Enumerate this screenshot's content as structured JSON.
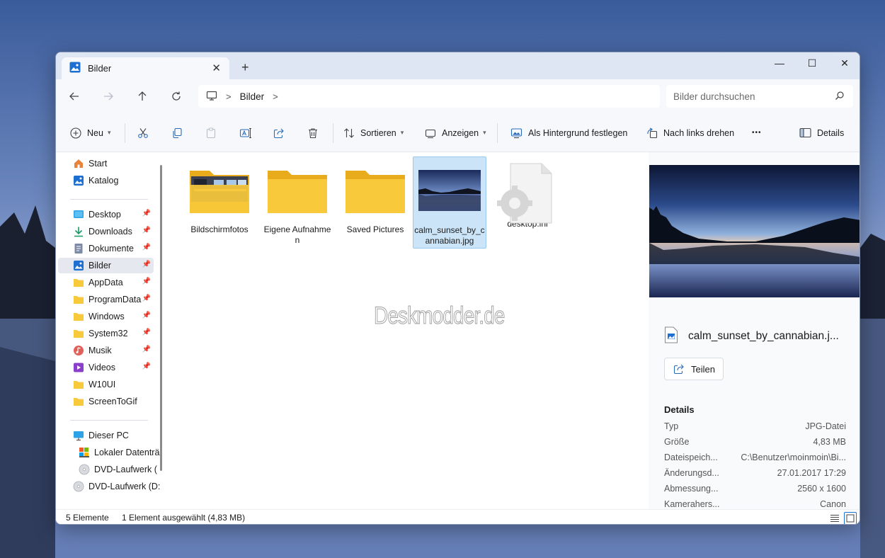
{
  "window": {
    "tab_title": "Bilder",
    "new_tab_symbol": "+",
    "tab_close_symbol": "✕",
    "minimize_symbol": "—",
    "maximize_symbol": "☐",
    "close_symbol": "✕"
  },
  "address": {
    "crumb": "Bilder",
    "search_placeholder": "Bilder durchsuchen"
  },
  "toolbar": {
    "new_label": "Neu",
    "sort_label": "Sortieren",
    "view_label": "Anzeigen",
    "wallpaper_label": "Als Hintergrund festlegen",
    "rotate_label": "Nach links drehen",
    "more_symbol": "•••",
    "details_label": "Details"
  },
  "sidebar": {
    "items": [
      {
        "label": "Start",
        "icon": "home-icon"
      },
      {
        "label": "Katalog",
        "icon": "gallery-icon"
      },
      {
        "label": "Desktop",
        "icon": "desktop-icon",
        "pinned": true
      },
      {
        "label": "Downloads",
        "icon": "download-icon",
        "pinned": true
      },
      {
        "label": "Dokumente",
        "icon": "document-icon",
        "pinned": true
      },
      {
        "label": "Bilder",
        "icon": "pictures-icon",
        "pinned": true,
        "active": true
      },
      {
        "label": "AppData",
        "icon": "folder-icon",
        "pinned": true
      },
      {
        "label": "ProgramData",
        "icon": "folder-icon",
        "pinned": true
      },
      {
        "label": "Windows",
        "icon": "folder-icon",
        "pinned": true
      },
      {
        "label": "System32",
        "icon": "folder-icon",
        "pinned": true
      },
      {
        "label": "Musik",
        "icon": "music-icon",
        "pinned": true
      },
      {
        "label": "Videos",
        "icon": "video-icon",
        "pinned": true
      },
      {
        "label": "W10UI",
        "icon": "folder-icon"
      },
      {
        "label": "ScreenToGif",
        "icon": "folder-icon"
      },
      {
        "label": "Dieser PC",
        "icon": "pc-icon"
      },
      {
        "label": "Lokaler Datenträ",
        "icon": "drive-icon"
      },
      {
        "label": "DVD-Laufwerk (",
        "icon": "dvd-icon"
      },
      {
        "label": "DVD-Laufwerk (D:",
        "icon": "dvd-icon"
      }
    ],
    "pin_symbol": "📌"
  },
  "files": [
    {
      "name": "Bildschirmfotos",
      "type": "folder-screenshots"
    },
    {
      "name": "Eigene Aufnahmen",
      "type": "folder"
    },
    {
      "name": "Saved Pictures",
      "type": "folder"
    },
    {
      "name": "calm_sunset_by_cannabian.jpg",
      "type": "image",
      "selected": true
    },
    {
      "name": "desktop.ini",
      "type": "settings-file"
    }
  ],
  "watermark": "Deskmodder.de",
  "preview": {
    "filename": "calm_sunset_by_cannabian.j...",
    "share_label": "Teilen",
    "details_title": "Details",
    "rows": [
      {
        "key": "Typ",
        "value": "JPG-Datei"
      },
      {
        "key": "Größe",
        "value": "4,83 MB"
      },
      {
        "key": "Dateispeich...",
        "value": "C:\\Benutzer\\moinmoin\\Bi..."
      },
      {
        "key": "Änderungsd...",
        "value": "27.01.2017 17:29"
      },
      {
        "key": "Abmessung...",
        "value": "2560 x 1600"
      },
      {
        "key": "Kamerahers...",
        "value": "Canon"
      }
    ]
  },
  "status": {
    "count": "5 Elemente",
    "selection": "1 Element ausgewählt (4,83 MB)"
  },
  "colors": {
    "accent": "#0067c0",
    "folder": "#f8c93b",
    "selection": "#cce4f7"
  }
}
